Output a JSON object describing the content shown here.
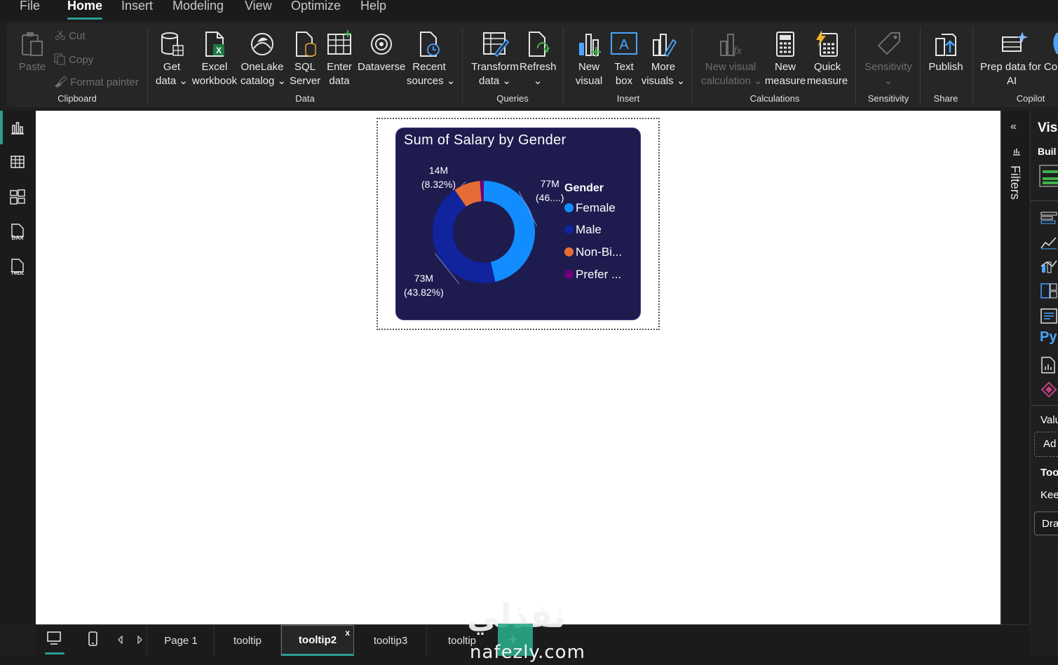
{
  "menu": [
    "File",
    "Home",
    "Insert",
    "Modeling",
    "View",
    "Optimize",
    "Help"
  ],
  "menu_active": "Home",
  "clipboard": {
    "paste": "Paste",
    "cut": "Cut",
    "copy": "Copy",
    "format_painter": "Format painter",
    "group": "Clipboard"
  },
  "data_group": {
    "get_data": [
      "Get",
      "data"
    ],
    "excel": [
      "Excel",
      "workbook"
    ],
    "onelake": [
      "OneLake",
      "catalog"
    ],
    "sql": [
      "SQL",
      "Server"
    ],
    "enter": [
      "Enter",
      "data"
    ],
    "dataverse": "Dataverse",
    "recent": [
      "Recent",
      "sources"
    ],
    "group": "Data"
  },
  "queries": {
    "transform": [
      "Transform",
      "data"
    ],
    "refresh": "Refresh",
    "group": "Queries"
  },
  "insert": {
    "new_visual": [
      "New",
      "visual"
    ],
    "text_box": [
      "Text",
      "box"
    ],
    "more_visuals": [
      "More",
      "visuals"
    ],
    "group": "Insert"
  },
  "calculations": {
    "new_visual_calc": [
      "New visual",
      "calculation"
    ],
    "new_measure": [
      "New",
      "measure"
    ],
    "quick_measure": [
      "Quick",
      "measure"
    ],
    "group": "Calculations"
  },
  "sensitivity": {
    "label": "Sensitivity",
    "group": "Sensitivity"
  },
  "share": {
    "publish": "Publish",
    "group": "Share"
  },
  "copilot": {
    "prep": [
      "Prep data for Co",
      "AI"
    ],
    "group": "Copilot"
  },
  "filters_label": "Filters",
  "right_pane": {
    "title": "Visu",
    "build": "Buil",
    "values": "Valu",
    "add": "Ad",
    "tooltips": "Too",
    "keep": "Kee",
    "drag": "Dra"
  },
  "chart_data": {
    "type": "pie",
    "title": "Sum of Salary by Gender",
    "legend_title": "Gender",
    "legend_position": "right",
    "categories": [
      "Female",
      "Male",
      "Non-Bi...",
      "Prefer ..."
    ],
    "values": [
      77,
      73,
      14,
      2
    ],
    "data_labels": [
      [
        "77M",
        "(46....)"
      ],
      [
        "73M",
        "(43.82%)"
      ],
      [
        "14M",
        "(8.32%)"
      ]
    ],
    "colors": [
      "#118dff",
      "#12239e",
      "#e66c37",
      "#6b007b"
    ],
    "background": "#1e1b4f"
  },
  "tabs": [
    "Page 1",
    "tooltip",
    "tooltip2",
    "tooltip3",
    "tooltip"
  ],
  "active_tab": "tooltip2",
  "add_tab": "+",
  "close_tab": "x",
  "watermark": {
    "arabic": "نفذلي",
    "latin": "nafezly.com"
  }
}
